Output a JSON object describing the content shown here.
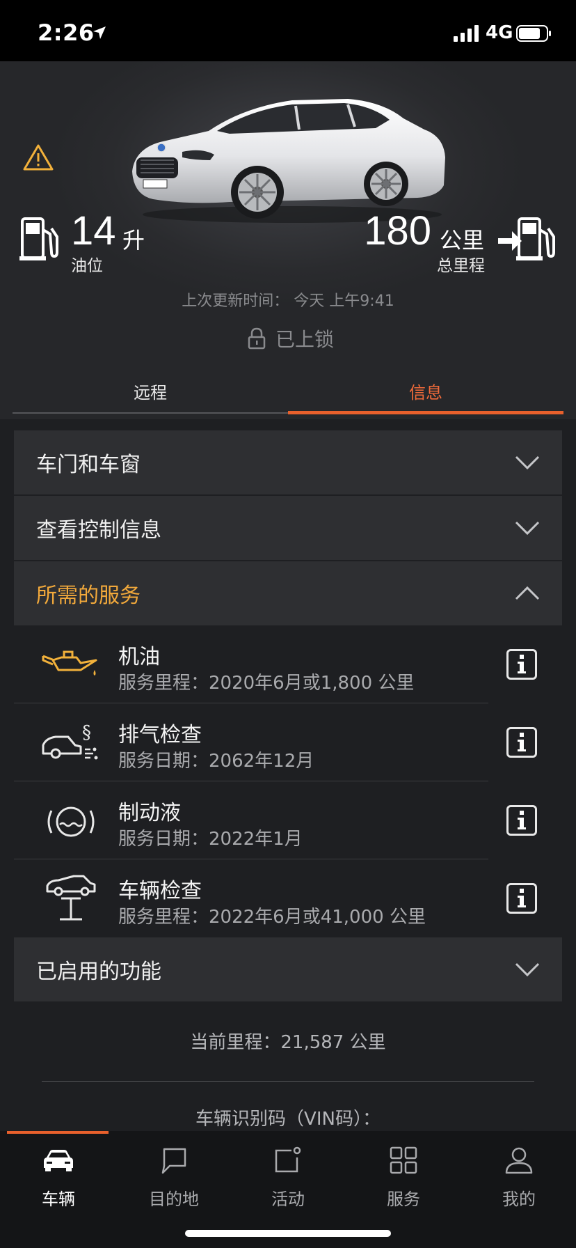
{
  "status_bar": {
    "time": "2:26",
    "network": "4G"
  },
  "hero": {
    "fuel_value": "14",
    "fuel_unit": "升",
    "fuel_label": "油位",
    "range_value": "180",
    "range_unit": "公里",
    "range_label": "总里程",
    "last_updated": "上次更新时间：  今天  上午9:41",
    "lock_status": "已上锁"
  },
  "tabs": [
    {
      "label": "远程",
      "active": false
    },
    {
      "label": "信息",
      "active": true
    }
  ],
  "sections": {
    "doors_windows": "车门和车窗",
    "check_control": "查看控制信息",
    "required_services": "所需的服务",
    "enabled_features": "已启用的功能"
  },
  "services": [
    {
      "icon": "oil-can-icon",
      "title": "机油",
      "subtitle": "服务里程：2020年6月或1,800 公里"
    },
    {
      "icon": "exhaust-inspection-icon",
      "title": "排气检查",
      "subtitle": "服务日期：2062年12月"
    },
    {
      "icon": "brake-fluid-icon",
      "title": "制动液",
      "subtitle": "服务日期：2022年1月"
    },
    {
      "icon": "vehicle-inspection-icon",
      "title": "车辆检查",
      "subtitle": "服务里程：2022年6月或41,000 公里"
    }
  ],
  "info": {
    "current_mileage": "当前里程：21,587 公里",
    "vin_label": "车辆识别码（VIN码）："
  },
  "nav": [
    {
      "label": "车辆",
      "active": true
    },
    {
      "label": "目的地",
      "active": false
    },
    {
      "label": "活动",
      "active": false
    },
    {
      "label": "服务",
      "active": false
    },
    {
      "label": "我的",
      "active": false
    }
  ],
  "colors": {
    "accent": "#e8602c",
    "highlight": "#f2a93b",
    "warning": "#f2b13b"
  }
}
